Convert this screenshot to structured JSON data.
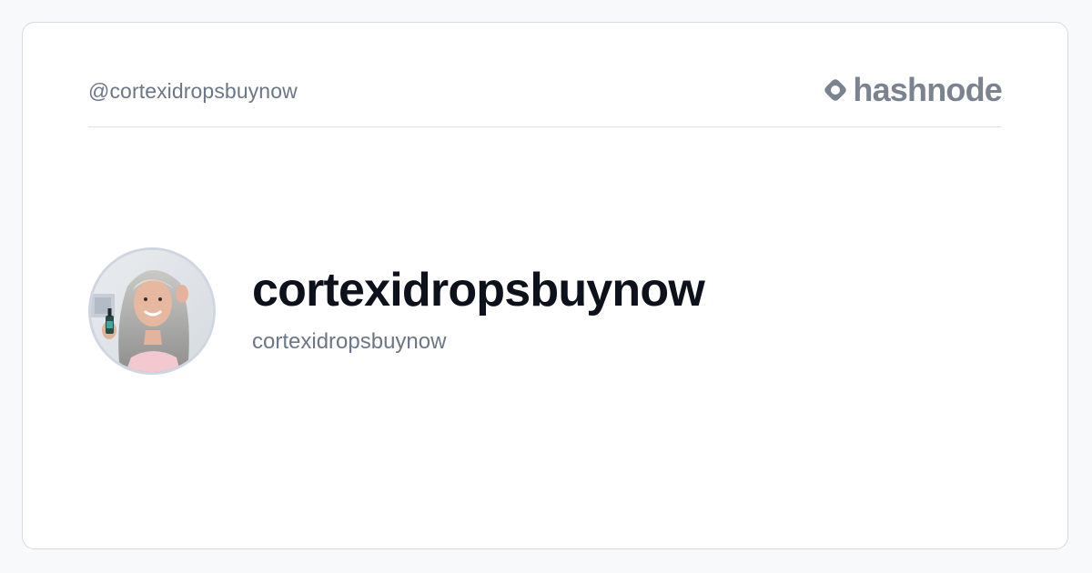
{
  "card": {
    "handle": "@cortexidropsbuynow",
    "brand": {
      "name": "hashnode",
      "icon": "hashnode-logo-icon",
      "color": "#7b8290"
    }
  },
  "profile": {
    "avatar_icon": "avatar",
    "display_name": "cortexidropsbuynow",
    "username": "cortexidropsbuynow"
  },
  "colors": {
    "background": "#f8f9fb",
    "card": "#ffffff",
    "title": "#0d111b",
    "muted": "#6b7787"
  }
}
